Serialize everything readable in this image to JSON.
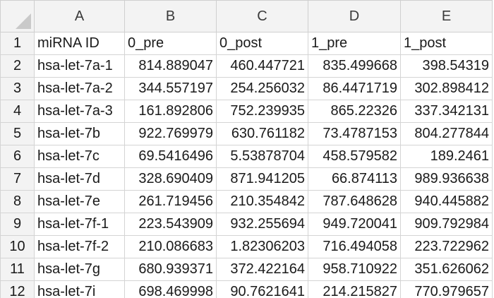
{
  "columns": [
    "A",
    "B",
    "C",
    "D",
    "E"
  ],
  "rows": [
    {
      "num": "1",
      "cells": [
        "miRNA ID",
        "0_pre",
        "0_post",
        "1_pre",
        "1_post"
      ]
    },
    {
      "num": "2",
      "cells": [
        "hsa-let-7a-1",
        "814.889047",
        "460.447721",
        "835.499668",
        "398.54319"
      ]
    },
    {
      "num": "3",
      "cells": [
        "hsa-let-7a-2",
        "344.557197",
        "254.256032",
        "86.4471719",
        "302.898412"
      ]
    },
    {
      "num": "4",
      "cells": [
        "hsa-let-7a-3",
        "161.892806",
        "752.239935",
        "865.22326",
        "337.342131"
      ]
    },
    {
      "num": "5",
      "cells": [
        "hsa-let-7b",
        "922.769979",
        "630.761182",
        "73.4787153",
        "804.277844"
      ]
    },
    {
      "num": "6",
      "cells": [
        "hsa-let-7c",
        "69.5416496",
        "5.53878704",
        "458.579582",
        "189.2461"
      ]
    },
    {
      "num": "7",
      "cells": [
        "hsa-let-7d",
        "328.690409",
        "871.941205",
        "66.874113",
        "989.936638"
      ]
    },
    {
      "num": "8",
      "cells": [
        "hsa-let-7e",
        "261.719456",
        "210.354842",
        "787.648628",
        "940.445882"
      ]
    },
    {
      "num": "9",
      "cells": [
        "hsa-let-7f-1",
        "223.543909",
        "932.255694",
        "949.720041",
        "909.792984"
      ]
    },
    {
      "num": "10",
      "cells": [
        "hsa-let-7f-2",
        "210.086683",
        "1.82306203",
        "716.494058",
        "223.722962"
      ]
    },
    {
      "num": "11",
      "cells": [
        "hsa-let-7g",
        "680.939371",
        "372.422164",
        "958.710922",
        "351.626062"
      ]
    },
    {
      "num": "12",
      "cells": [
        "hsa-let-7i",
        "698.469998",
        "90.7621641",
        "214.215827",
        "770.979657"
      ]
    }
  ]
}
